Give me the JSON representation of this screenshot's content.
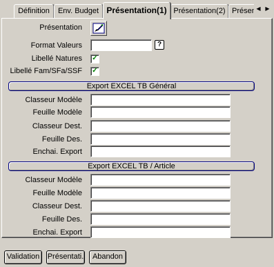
{
  "tabs": [
    {
      "label": "Définition"
    },
    {
      "label": "Env. Budget"
    },
    {
      "label": "Présentation(1)"
    },
    {
      "label": "Présentation(2)"
    },
    {
      "label": "Présen"
    }
  ],
  "tab_scroll": {
    "left": "◀",
    "right": "▶"
  },
  "form": {
    "presentation_label": "Présentation",
    "format_valeurs_label": "Format Valeurs",
    "format_valeurs_value": "",
    "help_glyph": "?",
    "libelle_natures_label": "Libellé Natures",
    "libelle_natures_checked": true,
    "libelle_fam_label": "Libellé Fam/SFa/SSF",
    "libelle_fam_checked": true,
    "check_glyph": "✓"
  },
  "section1": {
    "title": "Export EXCEL TB Général",
    "fields": [
      {
        "label": "Classeur Modèle",
        "value": ""
      },
      {
        "label": "Feuille Modèle",
        "value": ""
      },
      {
        "label": "Classeur Dest.",
        "value": ""
      },
      {
        "label": "Feuille Des.",
        "value": ""
      },
      {
        "label": "Enchai. Export",
        "value": ""
      }
    ]
  },
  "section2": {
    "title": "Export EXCEL TB / Article",
    "fields": [
      {
        "label": "Classeur Modèle",
        "value": ""
      },
      {
        "label": "Feuille Modèle",
        "value": ""
      },
      {
        "label": "Classeur Dest.",
        "value": ""
      },
      {
        "label": "Feuille Des.",
        "value": ""
      },
      {
        "label": "Enchai. Export",
        "value": ""
      }
    ]
  },
  "buttons": {
    "validation": "Validation",
    "presentation": "Présentati.",
    "abandon": "Abandon"
  }
}
